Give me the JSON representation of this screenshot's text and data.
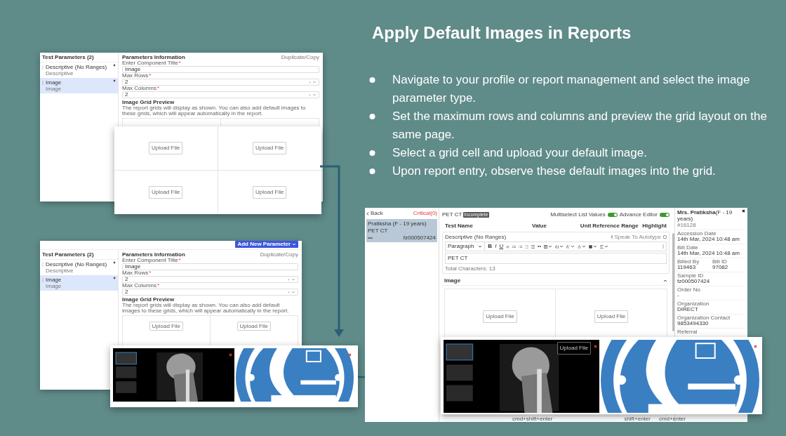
{
  "title": "Apply Default Images in Reports",
  "steps": [
    "Navigate to your profile or report management and select the image parameter type.",
    "Set the maximum rows and columns and preview the grid layout on the same page.",
    "Select a grid cell and upload your default image.",
    "Upon report entry, observe these default images into the grid."
  ],
  "setup_screens": [
    {
      "sidebar_title": "Test Parameters (2)",
      "parameters": [
        {
          "name": "Descriptive (No Ranges)",
          "type": "Descriptive",
          "selected": false
        },
        {
          "name": "Image",
          "type": "Image",
          "selected": true
        }
      ],
      "section_title": "Parameters Information",
      "copy_link": "Duplicate/Copy",
      "fields": [
        {
          "label": "Enter Component Title",
          "mark": "*",
          "value": "Image",
          "kind": "text"
        },
        {
          "label": "Max Rows",
          "mark": "*",
          "value": "2",
          "kind": "select"
        },
        {
          "label": "Max Columns",
          "mark": "*",
          "value": "2",
          "kind": "select"
        }
      ],
      "preview_title": "Image Grid Preview",
      "preview_note": "The report grids will display as shown. You can also add default images to these grids, which will appear automatically in the report."
    },
    {
      "add_button": "Add New Parameter",
      "sidebar_title": "Test Parameters (2)",
      "parameters": [
        {
          "name": "Descriptive (No Ranges)",
          "type": "Descriptive",
          "selected": false
        },
        {
          "name": "Image",
          "type": "Image",
          "selected": true
        }
      ],
      "section_title": "Parameters Information",
      "copy_link": "Duplicate/Copy",
      "fields": [
        {
          "label": "Enter Component Title",
          "mark": "*",
          "value": "Image",
          "kind": "text"
        },
        {
          "label": "Max Rows",
          "mark": "*",
          "value": "2",
          "kind": "select"
        },
        {
          "label": "Max Columns",
          "mark": "*",
          "value": "2",
          "kind": "select"
        }
      ],
      "preview_title": "Image Grid Preview",
      "preview_note": "The report grids will display as shown. You can also add default images to these grids, which will appear automatically in the report.",
      "grid_buttons": [
        "Upload File",
        "Upload File"
      ]
    }
  ],
  "grid_zoom": {
    "buttons": [
      "Upload File",
      "Upload File",
      "Upload File",
      "Upload File"
    ]
  },
  "report_screen": {
    "back": "Back",
    "critical": "Critical(0)",
    "patients": [
      {
        "name": "Pratiksha (F - 19 years)",
        "test": "PET CT",
        "id": "fz000507424",
        "selected": true
      }
    ],
    "test_title": "PET CT",
    "status_badge": "Incomplete",
    "toggles": [
      {
        "label": "Multiselect List Values",
        "on": true
      },
      {
        "label": "Advance Editor",
        "on": true
      }
    ],
    "columns": [
      "Test Name",
      "Value",
      "Unit",
      "Reference Range",
      "Highlight"
    ],
    "descriptive": {
      "name": "Descriptive (No Ranges)",
      "speak": "Speak To Autotype",
      "checked": false,
      "block_style": "Paragraph",
      "format_buttons": [
        "B",
        "I",
        "U"
      ],
      "content": "PET CT",
      "char_count": "Total Characters: 13"
    },
    "image_section": {
      "title": "Image",
      "expanded": true,
      "buttons": [
        "Upload File",
        "Upload File"
      ]
    },
    "details": {
      "name": "**Mrs. Pratiksha**(F - 19 years)",
      "number": "#16128",
      "rows": [
        [
          {
            "label": "Accession Date",
            "value": "14th Mar, 2024 10:48 am"
          }
        ],
        [
          {
            "label": "Bill Date",
            "value": "14th Mar, 2024 10:48 am"
          }
        ],
        [
          {
            "label": "Billed By",
            "value": "119463"
          },
          {
            "label": "Bill ID",
            "value": "97082"
          }
        ],
        [
          {
            "label": "Sample ID",
            "value": "fz000507424"
          }
        ],
        [
          {
            "label": "Order No",
            "value": "-"
          }
        ],
        [
          {
            "label": "Organization",
            "value": "DIRECT"
          }
        ],
        [
          {
            "label": "Organization Contact",
            "value": "9853494330"
          }
        ],
        [
          {
            "label": "Referral"
          }
        ]
      ]
    },
    "shortcuts": [
      "cmd+shift+enter",
      "shift+enter",
      "cmd+enter"
    ]
  },
  "image_zoom": {
    "upload_button": "Upload File"
  }
}
